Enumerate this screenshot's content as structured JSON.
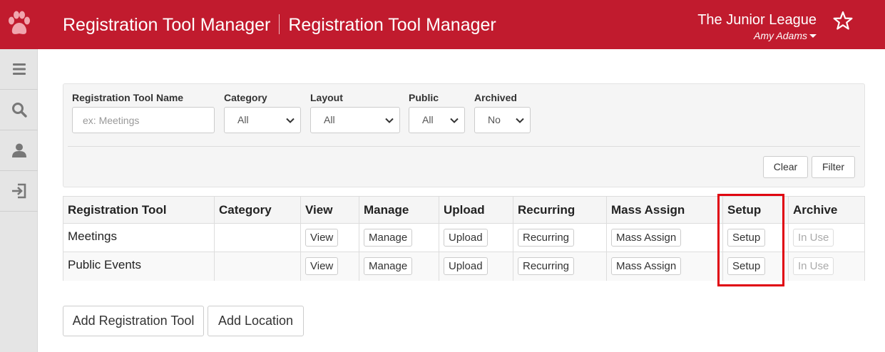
{
  "header": {
    "title_left": "Registration Tool Manager",
    "title_right": "Registration Tool Manager",
    "organization": "The Junior League",
    "user_name": "Amy Adams",
    "brand_color": "#c11b2e"
  },
  "sidebar": {
    "items": [
      {
        "icon": "menu-icon"
      },
      {
        "icon": "search-icon"
      },
      {
        "icon": "user-icon"
      },
      {
        "icon": "sign-out-icon"
      }
    ]
  },
  "filters": {
    "name_label": "Registration Tool Name",
    "name_placeholder": "ex: Meetings",
    "category_label": "Category",
    "category_value": "All",
    "layout_label": "Layout",
    "layout_value": "All",
    "public_label": "Public",
    "public_value": "All",
    "archived_label": "Archived",
    "archived_value": "No",
    "clear_label": "Clear",
    "filter_label": "Filter"
  },
  "table": {
    "headers": [
      "Registration Tool",
      "Category",
      "View",
      "Manage",
      "Upload",
      "Recurring",
      "Mass Assign",
      "Setup",
      "Archive"
    ],
    "rows": [
      {
        "name": "Meetings",
        "category": "",
        "view": "View",
        "manage": "Manage",
        "upload": "Upload",
        "recurring": "Recurring",
        "mass_assign": "Mass Assign",
        "setup": "Setup",
        "archive": "In Use"
      },
      {
        "name": "Public Events",
        "category": "",
        "view": "View",
        "manage": "Manage",
        "upload": "Upload",
        "recurring": "Recurring",
        "mass_assign": "Mass Assign",
        "setup": "Setup",
        "archive": "In Use"
      }
    ]
  },
  "actions": {
    "add_tool_label": "Add Registration Tool",
    "add_location_label": "Add Location"
  },
  "highlight_color": "#e0000f"
}
